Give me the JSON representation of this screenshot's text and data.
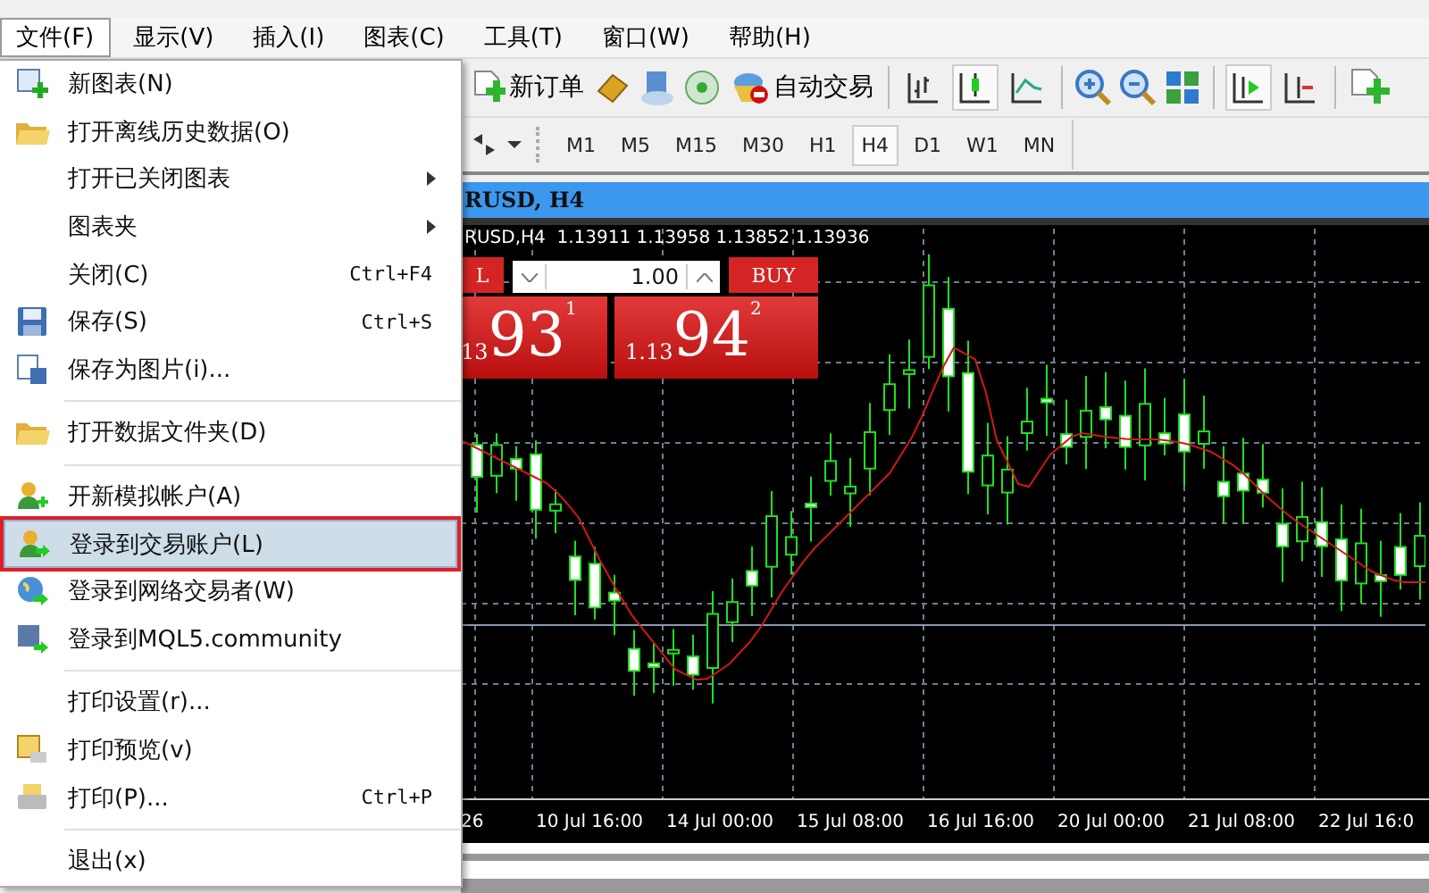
{
  "menubar": [
    {
      "label": "文件(F)",
      "selected": true
    },
    {
      "label": "显示(V)",
      "selected": false
    },
    {
      "label": "插入(I)",
      "selected": false
    },
    {
      "label": "图表(C)",
      "selected": false
    },
    {
      "label": "工具(T)",
      "selected": false
    },
    {
      "label": "窗口(W)",
      "selected": false
    },
    {
      "label": "帮助(H)",
      "selected": false
    }
  ],
  "toolbar": {
    "new_order": "新订单",
    "auto_trading": "自动交易",
    "chart_types": [
      {
        "selected": false
      },
      {
        "selected": true
      },
      {
        "selected": false
      }
    ],
    "auto_scroll": {
      "selected": true
    },
    "chart_shift": {
      "selected": false
    }
  },
  "timeframes": [
    {
      "label": "M1",
      "selected": false
    },
    {
      "label": "M5",
      "selected": false
    },
    {
      "label": "M15",
      "selected": false
    },
    {
      "label": "M30",
      "selected": false
    },
    {
      "label": "H1",
      "selected": false
    },
    {
      "label": "H4",
      "selected": true
    },
    {
      "label": "D1",
      "selected": false
    },
    {
      "label": "W1",
      "selected": false
    },
    {
      "label": "MN",
      "selected": false
    }
  ],
  "chart": {
    "title": "RUSD, H4",
    "info": "RUSD,H4  1.13911 1.13958 1.13852 1.13936",
    "sell": {
      "label": "L",
      "prefix": "13",
      "big": "93",
      "sup": "1"
    },
    "volume": "1.00",
    "buy": {
      "label": "BUY",
      "prefix": "1.13",
      "big": "94",
      "sup": "2"
    },
    "x_labels": [
      "26",
      "10 Jul 16:00",
      "14 Jul 00:00",
      "15 Jul 08:00",
      "16 Jul 16:00",
      "20 Jul 00:00",
      "21 Jul 08:00",
      "22 Jul 16:0"
    ]
  },
  "file_menu": [
    {
      "kind": "item",
      "label": "新图表(N)",
      "submenu": false,
      "selected": false
    },
    {
      "kind": "item",
      "label": "打开离线历史数据(O)",
      "submenu": false,
      "selected": false
    },
    {
      "kind": "item",
      "label": "打开已关闭图表",
      "submenu": true,
      "selected": false
    },
    {
      "kind": "item",
      "label": "图表夹",
      "submenu": true,
      "selected": false
    },
    {
      "kind": "item",
      "label": "关闭(C)",
      "shortcut": "Ctrl+F4",
      "submenu": false,
      "selected": false
    },
    {
      "kind": "item",
      "label": "保存(S)",
      "shortcut": "Ctrl+S",
      "submenu": false,
      "selected": false
    },
    {
      "kind": "item",
      "label": "保存为图片(i)...",
      "submenu": false,
      "selected": false
    },
    {
      "kind": "separator"
    },
    {
      "kind": "item",
      "label": "打开数据文件夹(D)",
      "submenu": false,
      "selected": false
    },
    {
      "kind": "separator"
    },
    {
      "kind": "item",
      "label": "开新模拟帐户(A)",
      "submenu": false,
      "selected": false
    },
    {
      "kind": "item",
      "label": "登录到交易账户(L)",
      "submenu": false,
      "selected": true
    },
    {
      "kind": "item",
      "label": "登录到网络交易者(W)",
      "submenu": false,
      "selected": false
    },
    {
      "kind": "item",
      "label": "登录到MQL5.community",
      "submenu": false,
      "selected": false
    },
    {
      "kind": "separator"
    },
    {
      "kind": "item",
      "label": "打印设置(r)...",
      "submenu": false,
      "selected": false
    },
    {
      "kind": "item",
      "label": "打印预览(v)",
      "submenu": false,
      "selected": false
    },
    {
      "kind": "item",
      "label": "打印(P)...",
      "shortcut": "Ctrl+P",
      "submenu": false,
      "selected": false
    },
    {
      "kind": "separator"
    },
    {
      "kind": "item",
      "label": "退出(x)",
      "submenu": false,
      "selected": false
    }
  ]
}
